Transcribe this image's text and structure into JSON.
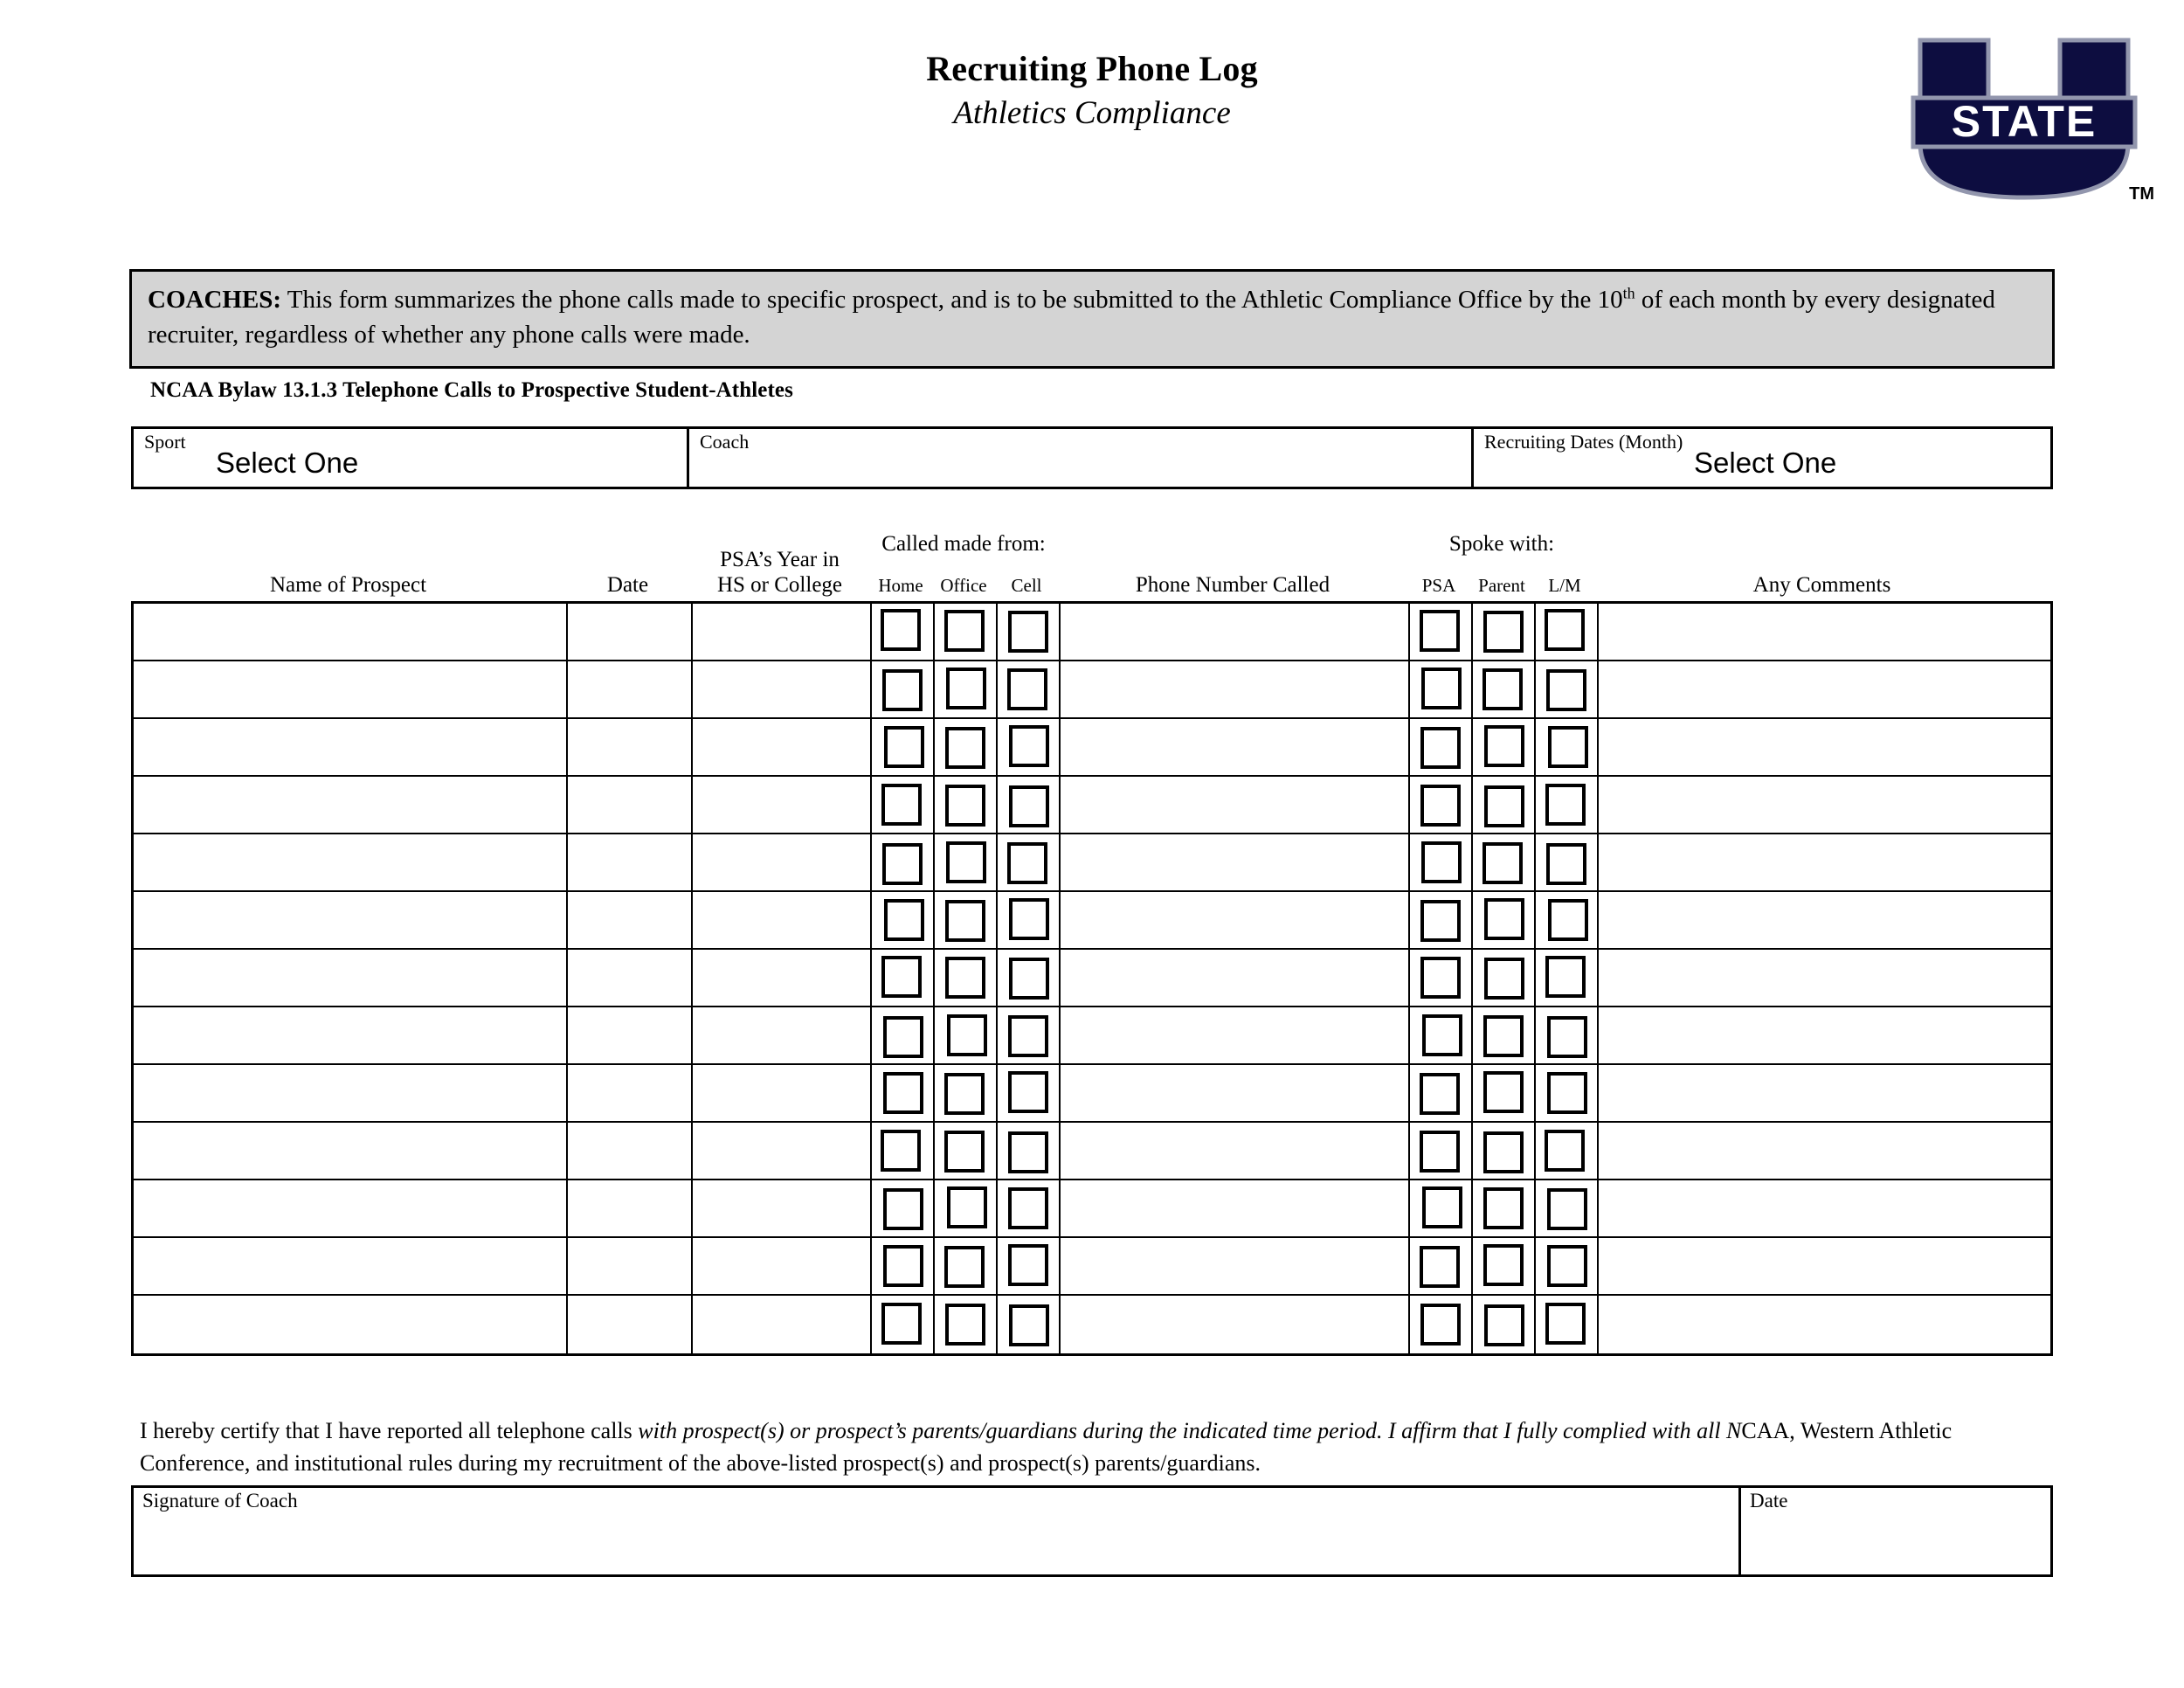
{
  "header": {
    "title": "Recruiting Phone Log",
    "subtitle": "Athletics Compliance",
    "logo": {
      "letter": "U",
      "word": "STATE",
      "tm": "TM",
      "navy": "#0d0d40",
      "outline": "#8b8fa8"
    }
  },
  "notice": {
    "label": "COACHES:",
    "text_part1": " This form summarizes the phone calls made to specific prospect, and is to be submitted to the Athletic Compliance Office by the ",
    "ordinal_number": "10",
    "ordinal_suffix": "th",
    "text_part2": " of each month by every designated recruiter, regardless of whether any phone calls were made.",
    "bg_color": "#d4d4d4"
  },
  "bylaw": "NCAA Bylaw 13.1.3 Telephone Calls to Prospective Student-Athletes",
  "meta": {
    "sport": {
      "label": "Sport",
      "value": "Select One"
    },
    "coach": {
      "label": "Coach",
      "value": ""
    },
    "dates": {
      "label": "Recruiting Dates (Month)",
      "value": "Select One"
    }
  },
  "table": {
    "headers": {
      "name": "Name of Prospect",
      "date": "Date",
      "year_line1": "PSA’s Year in",
      "year_line2": "HS or College",
      "called_from_group": "Called made from:",
      "called_from": [
        "Home",
        "Office",
        "Cell"
      ],
      "phone": "Phone Number Called",
      "spoke_with_group": "Spoke with:",
      "spoke_with": [
        "PSA",
        "Parent",
        "L/M"
      ],
      "comments": "Any Comments"
    },
    "row_count": 13,
    "rows": [
      {
        "name": "",
        "date": "",
        "year": "",
        "home": false,
        "office": false,
        "cell": false,
        "phone": "",
        "psa": false,
        "parent": false,
        "lm": false,
        "comments": ""
      },
      {
        "name": "",
        "date": "",
        "year": "",
        "home": false,
        "office": false,
        "cell": false,
        "phone": "",
        "psa": false,
        "parent": false,
        "lm": false,
        "comments": ""
      },
      {
        "name": "",
        "date": "",
        "year": "",
        "home": false,
        "office": false,
        "cell": false,
        "phone": "",
        "psa": false,
        "parent": false,
        "lm": false,
        "comments": ""
      },
      {
        "name": "",
        "date": "",
        "year": "",
        "home": false,
        "office": false,
        "cell": false,
        "phone": "",
        "psa": false,
        "parent": false,
        "lm": false,
        "comments": ""
      },
      {
        "name": "",
        "date": "",
        "year": "",
        "home": false,
        "office": false,
        "cell": false,
        "phone": "",
        "psa": false,
        "parent": false,
        "lm": false,
        "comments": ""
      },
      {
        "name": "",
        "date": "",
        "year": "",
        "home": false,
        "office": false,
        "cell": false,
        "phone": "",
        "psa": false,
        "parent": false,
        "lm": false,
        "comments": ""
      },
      {
        "name": "",
        "date": "",
        "year": "",
        "home": false,
        "office": false,
        "cell": false,
        "phone": "",
        "psa": false,
        "parent": false,
        "lm": false,
        "comments": ""
      },
      {
        "name": "",
        "date": "",
        "year": "",
        "home": false,
        "office": false,
        "cell": false,
        "phone": "",
        "psa": false,
        "parent": false,
        "lm": false,
        "comments": ""
      },
      {
        "name": "",
        "date": "",
        "year": "",
        "home": false,
        "office": false,
        "cell": false,
        "phone": "",
        "psa": false,
        "parent": false,
        "lm": false,
        "comments": ""
      },
      {
        "name": "",
        "date": "",
        "year": "",
        "home": false,
        "office": false,
        "cell": false,
        "phone": "",
        "psa": false,
        "parent": false,
        "lm": false,
        "comments": ""
      },
      {
        "name": "",
        "date": "",
        "year": "",
        "home": false,
        "office": false,
        "cell": false,
        "phone": "",
        "psa": false,
        "parent": false,
        "lm": false,
        "comments": ""
      },
      {
        "name": "",
        "date": "",
        "year": "",
        "home": false,
        "office": false,
        "cell": false,
        "phone": "",
        "psa": false,
        "parent": false,
        "lm": false,
        "comments": ""
      },
      {
        "name": "",
        "date": "",
        "year": "",
        "home": false,
        "office": false,
        "cell": false,
        "phone": "",
        "psa": false,
        "parent": false,
        "lm": false,
        "comments": ""
      }
    ]
  },
  "certification": {
    "line1_a": "I hereby certify that I have reported all telephone calls ",
    "line1_italic": "with prospect(s) or prospect’s parents/guardians during the indicated time period.  I affirm that I fully complied with all N",
    "line1_b": "CAA,",
    "line2": "Western Athletic Conference, and institutional rules during my recruitment of the above-listed prospect(s) and prospect(s) parents/guardians."
  },
  "signature": {
    "coach_label": "Signature of Coach",
    "coach_value": "",
    "date_label": "Date",
    "date_value": ""
  }
}
